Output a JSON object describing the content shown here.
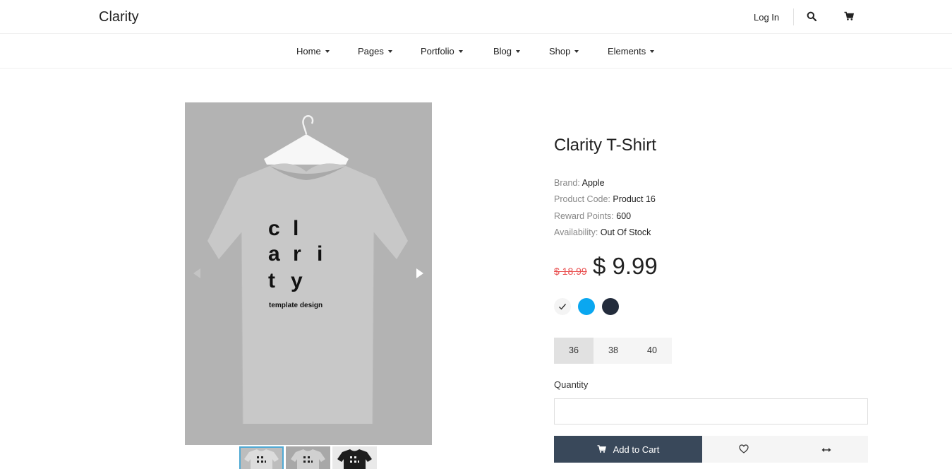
{
  "header": {
    "logo": "Clarity",
    "login_label": "Log In",
    "search_icon": "search-icon",
    "cart_icon": "cart-icon"
  },
  "nav": {
    "items": [
      {
        "label": "Home"
      },
      {
        "label": "Pages"
      },
      {
        "label": "Portfolio"
      },
      {
        "label": "Blog"
      },
      {
        "label": "Shop"
      },
      {
        "label": "Elements"
      }
    ]
  },
  "gallery": {
    "shirt_print": [
      "c",
      "l",
      "a",
      "r",
      "i",
      "t",
      "y"
    ],
    "shirt_tagline": "template design",
    "thumbnail_count": 3,
    "active_thumbnail": 1
  },
  "product": {
    "title": "Clarity T-Shirt",
    "brand_label": "Brand:",
    "brand": "Apple",
    "code_label": "Product Code:",
    "code": "Product 16",
    "points_label": "Reward Points:",
    "points": "600",
    "availability_label": "Availability:",
    "availability": "Out Of Stock",
    "old_price": "$ 18.99",
    "price": "$ 9.99",
    "colors": [
      "#f4f4f4",
      "#0aa7f0",
      "#232c3c"
    ],
    "selected_color": 0,
    "sizes": [
      "36",
      "38",
      "40"
    ],
    "selected_size": "36",
    "quantity_label": "Quantity",
    "quantity_value": "",
    "add_to_cart_label": "Add to Cart"
  }
}
